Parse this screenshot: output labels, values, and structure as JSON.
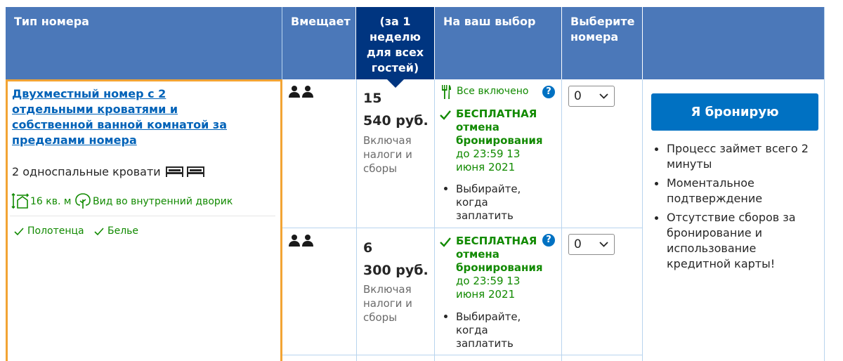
{
  "header": {
    "room_type": "Тип номера",
    "capacity": "Вмещает",
    "price_col": [
      "(за 1",
      "неделю",
      "для всех",
      "гостей)"
    ],
    "your_choice": "На ваш выбор",
    "select_rooms": [
      "Выберите",
      "номера"
    ]
  },
  "room": {
    "name_lines": [
      "Двухместный номер с 2",
      "отдельными кроватями и",
      "собственной ванной комнатой за",
      "пределами номера"
    ],
    "beds": "2 односпальные кровати",
    "area": "16 кв. м",
    "view": "Вид во внутренний дворик",
    "amenities": [
      "Полотенца",
      "Белье"
    ]
  },
  "options": [
    {
      "price_line1": "15",
      "price_line2": "540 руб.",
      "taxes": [
        "Включая",
        "налоги и",
        "сборы"
      ],
      "meal": "Все включено",
      "free_cancel": [
        "БЕСПЛАТНАЯ",
        "отмена",
        "бронирования"
      ],
      "cancel_until": [
        "до 23:59 13",
        "июня 2021"
      ],
      "pay": [
        "Выбирайте,",
        "когда",
        "заплатить"
      ],
      "select_value": "0"
    },
    {
      "price_line1": "6",
      "price_line2": "300 руб.",
      "taxes": [
        "Включая",
        "налоги и",
        "сборы"
      ],
      "free_cancel": [
        "БЕСПЛАТНАЯ",
        "отмена",
        "бронирования"
      ],
      "cancel_until": [
        "до 23:59 13",
        "июня 2021"
      ],
      "pay": [
        "Выбирайте,",
        "когда",
        "заплатить"
      ],
      "select_value": "0"
    }
  ],
  "booking": {
    "button": "Я бронирую",
    "bullets": [
      [
        "Процесс займет всего 2",
        "минуты"
      ],
      [
        "Моментальное",
        "подтверждение"
      ],
      [
        "Отсутствие сборов за",
        "бронирование и",
        "использование",
        "кредитной карты!"
      ]
    ]
  },
  "colors": {
    "header": "#4b78b9",
    "header_dark": "#003580",
    "button": "#0071c2",
    "green": "#118a00",
    "highlight": "#f2a434"
  }
}
